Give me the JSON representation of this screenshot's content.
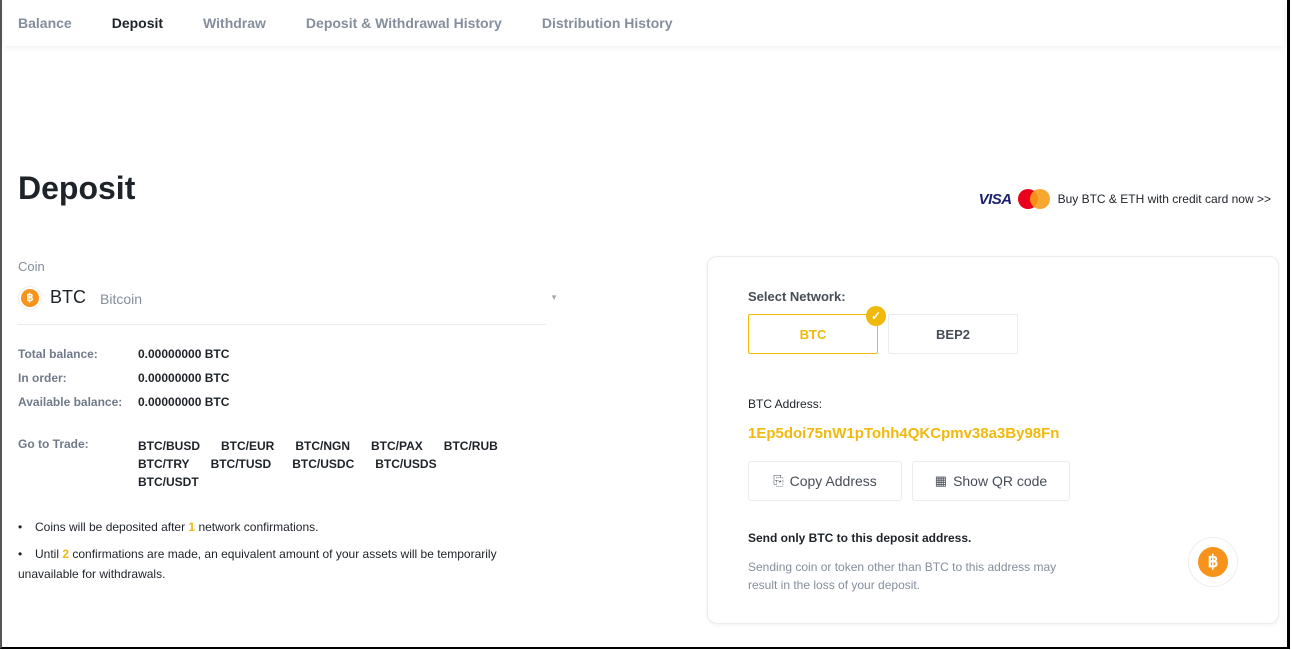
{
  "nav": {
    "tabs": [
      {
        "label": "Balance",
        "active": false
      },
      {
        "label": "Deposit",
        "active": true
      },
      {
        "label": "Withdraw",
        "active": false
      },
      {
        "label": "Deposit & Withdrawal History",
        "active": false
      },
      {
        "label": "Distribution History",
        "active": false
      }
    ]
  },
  "page": {
    "title": "Deposit"
  },
  "promo": {
    "visa": "VISA",
    "mastercard_icon": "mastercard-icon",
    "text": "Buy BTC & ETH with credit card now >>"
  },
  "coin": {
    "label": "Coin",
    "symbol": "BTC",
    "name": "Bitcoin",
    "icon_glyph": "฿",
    "icon_color": "#f7931a"
  },
  "balances": [
    {
      "label": "Total balance:",
      "value": "0.00000000 BTC"
    },
    {
      "label": "In order:",
      "value": "0.00000000 BTC"
    },
    {
      "label": "Available balance:",
      "value": "0.00000000 BTC"
    }
  ],
  "trade": {
    "label": "Go to Trade:",
    "pairs": [
      "BTC/BUSD",
      "BTC/EUR",
      "BTC/NGN",
      "BTC/PAX",
      "BTC/RUB",
      "BTC/TRY",
      "BTC/TUSD",
      "BTC/USDC",
      "BTC/USDS",
      "BTC/USDT"
    ]
  },
  "notes": {
    "n1_pre": "Coins will be deposited after ",
    "n1_num": "1",
    "n1_post": " network confirmations.",
    "n2_pre": "Until ",
    "n2_num": "2",
    "n2_post": " confirmations are made, an equivalent amount of your assets will be temporarily unavailable for withdrawals.",
    "bullet": "•"
  },
  "deposit_card": {
    "network_label": "Select Network:",
    "networks": [
      {
        "label": "BTC",
        "selected": true
      },
      {
        "label": "BEP2",
        "selected": false
      }
    ],
    "check_glyph": "✓",
    "address_label": "BTC Address:",
    "address": "1Ep5doi75nW1pTohh4QKCpmv38a3By98Fn",
    "copy_label": "Copy Address",
    "copy_glyph": "⎘",
    "qr_label": "Show QR code",
    "qr_glyph": "▦",
    "warning_title": "Send only BTC to this deposit address.",
    "warning_text": "Sending coin or token other than BTC to this address may result in the loss of your deposit."
  },
  "colors": {
    "accent": "#f0b90b",
    "btc": "#f7931a",
    "text_primary": "#1e2329",
    "text_secondary": "#848e9c"
  }
}
